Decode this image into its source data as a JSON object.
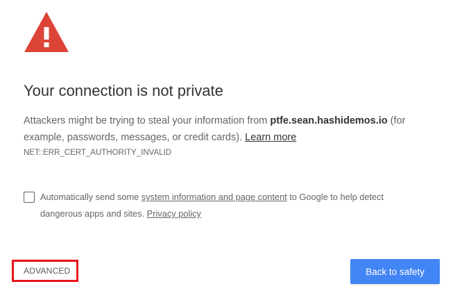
{
  "colors": {
    "warning_red": "#db4437",
    "primary_button": "#4285f4",
    "highlight_box": "#e8121a"
  },
  "icon": {
    "name": "warning-triangle-icon",
    "glyph": "!"
  },
  "title": "Your connection is not private",
  "message": {
    "before_host": "Attackers might be trying to steal your information from ",
    "host": "ptfe.sean.hashidemos.io",
    "after_host": " (for example, passwords, messages, or credit cards). ",
    "learn_more": "Learn more"
  },
  "error_code": "NET::ERR_CERT_AUTHORITY_INVALID",
  "optin": {
    "checked": false,
    "text_before": "Automatically send some ",
    "link": "system information and page content",
    "text_after": " to Google to help detect dangerous apps and sites. ",
    "privacy_link": "Privacy policy"
  },
  "buttons": {
    "advanced": "ADVANCED",
    "back_to_safety": "Back to safety"
  }
}
